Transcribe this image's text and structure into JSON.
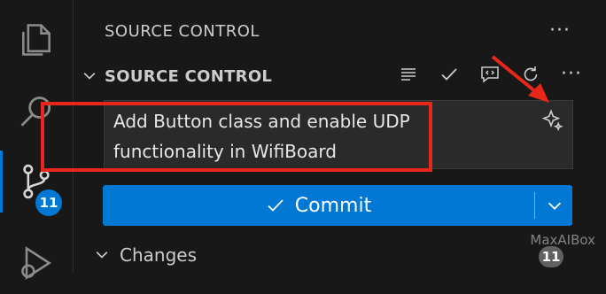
{
  "activity_bar": {
    "items": [
      {
        "name": "explorer",
        "icon": "files-icon"
      },
      {
        "name": "search",
        "icon": "search-icon"
      },
      {
        "name": "source-control",
        "icon": "source-control-icon",
        "badge": "11"
      },
      {
        "name": "run-debug",
        "icon": "run-debug-icon"
      }
    ]
  },
  "sidebar": {
    "header": "SOURCE CONTROL",
    "more": "···",
    "section_title": "SOURCE CONTROL",
    "section_more": "···",
    "commit_message": "Add Button class and enable UDP functionality in WifiBoard",
    "commit_label": "Commit",
    "changes_label": "Changes",
    "changes_count": "11"
  },
  "watermark": "MaxAIBox",
  "colors": {
    "accent": "#0078d4",
    "highlight": "#e8261a",
    "background": "#181818"
  }
}
